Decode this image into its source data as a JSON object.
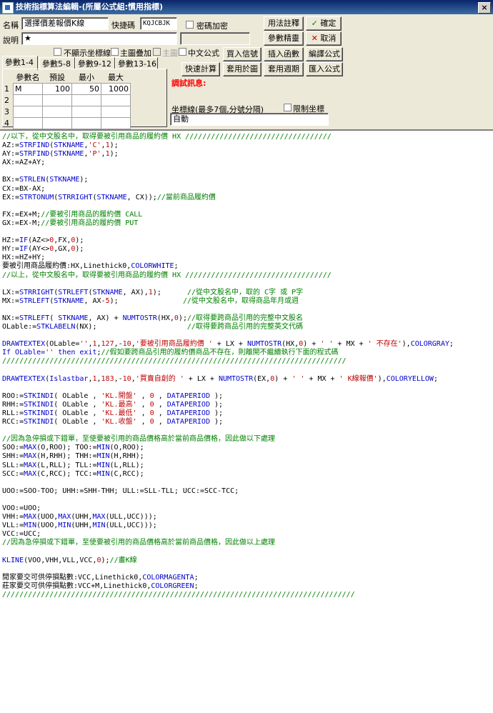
{
  "window": {
    "title": "技術指標算法編輯-(所屬公式組:慣用指標)",
    "close_label": "×"
  },
  "form": {
    "name_label": "名稱",
    "name_value": "選擇價差報價K線",
    "shortcut_label": "快捷碼",
    "shortcut_value": "KQJCBJK",
    "password_label": "密碼加密",
    "desc_label": "說明",
    "desc_value": "★",
    "no_axis_label": "不顯示坐標線",
    "main_overlay_label": "主圖疊加",
    "main_label": "主圖",
    "chinese_formula_label": "中文公式",
    "error_label": "調試訊息:",
    "axis_label": "坐標線(最多7個,分號分隔)",
    "limit_axis_label": "限制坐標",
    "axis_value": "自動"
  },
  "buttons": {
    "usage_note": "用法註釋",
    "ok": "確定",
    "param_wizard": "參數精靈",
    "cancel": "取消",
    "buy_sell": "買入信號",
    "insert_func": "插入函數",
    "compile": "編譯公式",
    "quick_calc": "快速計算",
    "apply_chart": "套用於圖",
    "apply_period": "套用週期",
    "import_formula": "匯入公式"
  },
  "tabs": [
    "參數1-4",
    "參數5-8",
    "參數9-12",
    "參數13-16"
  ],
  "params": {
    "headers": [
      "參數名",
      "預設",
      "最小",
      "最大"
    ],
    "rows": [
      {
        "n": "1",
        "name": "M",
        "def": "100",
        "min": "50",
        "max": "1000"
      },
      {
        "n": "2",
        "name": "",
        "def": "",
        "min": "",
        "max": ""
      },
      {
        "n": "3",
        "name": "",
        "def": "",
        "min": "",
        "max": ""
      },
      {
        "n": "4",
        "name": "",
        "def": "",
        "min": "",
        "max": ""
      }
    ]
  },
  "code_lines": [
    [
      [
        "cm",
        "//以下，從中文股名中，取得要被引用商品的履約價 HX //////////////////////////////////"
      ]
    ],
    [
      [
        "pl",
        "AZ:="
      ],
      [
        "kw",
        "STRFIND"
      ],
      [
        "pl",
        "("
      ],
      [
        "kw",
        "STKNAME"
      ],
      [
        "pl",
        ","
      ],
      [
        "st",
        "'C'"
      ],
      [
        "pl",
        ","
      ],
      [
        "nm",
        "1"
      ],
      [
        "pl",
        ");"
      ]
    ],
    [
      [
        "pl",
        "AY:="
      ],
      [
        "kw",
        "STRFIND"
      ],
      [
        "pl",
        "("
      ],
      [
        "kw",
        "STKNAME"
      ],
      [
        "pl",
        ","
      ],
      [
        "st",
        "'P'"
      ],
      [
        "pl",
        ","
      ],
      [
        "nm",
        "1"
      ],
      [
        "pl",
        ");"
      ]
    ],
    [
      [
        "pl",
        "AX:=AZ+AY;"
      ]
    ],
    [
      [
        "pl",
        ""
      ]
    ],
    [
      [
        "pl",
        "BX:="
      ],
      [
        "kw",
        "STRLEN"
      ],
      [
        "pl",
        "("
      ],
      [
        "kw",
        "STKNAME"
      ],
      [
        "pl",
        ");"
      ]
    ],
    [
      [
        "pl",
        "CX:=BX-AX;"
      ]
    ],
    [
      [
        "pl",
        "EX:="
      ],
      [
        "kw",
        "STRTONUM"
      ],
      [
        "pl",
        "("
      ],
      [
        "kw",
        "STRRIGHT"
      ],
      [
        "pl",
        "("
      ],
      [
        "kw",
        "STKNAME"
      ],
      [
        "pl",
        ", CX));"
      ],
      [
        "cm",
        "//當前商品履約價"
      ]
    ],
    [
      [
        "pl",
        ""
      ]
    ],
    [
      [
        "pl",
        "FX:=EX+M;"
      ],
      [
        "cm",
        "//要被引用商品的履約價 CALL"
      ]
    ],
    [
      [
        "pl",
        "GX:=EX-M;"
      ],
      [
        "cm",
        "//要被引用商品的履約價 PUT"
      ]
    ],
    [
      [
        "pl",
        ""
      ]
    ],
    [
      [
        "pl",
        "HZ:="
      ],
      [
        "kw",
        "IF"
      ],
      [
        "pl",
        "(AZ<>"
      ],
      [
        "nm",
        "0"
      ],
      [
        "pl",
        ",FX,"
      ],
      [
        "nm",
        "0"
      ],
      [
        "pl",
        ");"
      ]
    ],
    [
      [
        "pl",
        "HY:="
      ],
      [
        "kw",
        "IF"
      ],
      [
        "pl",
        "(AY<>"
      ],
      [
        "nm",
        "0"
      ],
      [
        "pl",
        ",GX,"
      ],
      [
        "nm",
        "0"
      ],
      [
        "pl",
        ");"
      ]
    ],
    [
      [
        "pl",
        "HX:=HZ+HY;"
      ]
    ],
    [
      [
        "pl",
        "要被引用商品履約價:HX,Linethick0,"
      ],
      [
        "kw",
        "COLORWHITE"
      ],
      [
        "pl",
        ";"
      ]
    ],
    [
      [
        "cm",
        "//以上，從中文股名中，取得要被引用商品的履約價 HX //////////////////////////////////"
      ]
    ],
    [
      [
        "pl",
        ""
      ]
    ],
    [
      [
        "pl",
        "LX:="
      ],
      [
        "kw",
        "STRRIGHT"
      ],
      [
        "pl",
        "("
      ],
      [
        "kw",
        "STRLEFT"
      ],
      [
        "pl",
        "("
      ],
      [
        "kw",
        "STKNAME"
      ],
      [
        "pl",
        ", AX),"
      ],
      [
        "nm",
        "1"
      ],
      [
        "pl",
        ");      "
      ],
      [
        "cm",
        "//從中文股名中，取的 C字 或 P字"
      ]
    ],
    [
      [
        "pl",
        "MX:="
      ],
      [
        "kw",
        "STRLEFT"
      ],
      [
        "pl",
        "("
      ],
      [
        "kw",
        "STKNAME"
      ],
      [
        "pl",
        ", AX-"
      ],
      [
        "nm",
        "5"
      ],
      [
        "pl",
        ");               "
      ],
      [
        "cm",
        "//從中文股名中，取得商品年月或週"
      ]
    ],
    [
      [
        "pl",
        ""
      ]
    ],
    [
      [
        "pl",
        "NX:="
      ],
      [
        "kw",
        "STRLEFT"
      ],
      [
        "pl",
        "( "
      ],
      [
        "kw",
        "STKNAME"
      ],
      [
        "pl",
        ", AX) + "
      ],
      [
        "kw",
        "NUMTOSTR"
      ],
      [
        "pl",
        "(HX,"
      ],
      [
        "nm",
        "0"
      ],
      [
        "pl",
        ");"
      ],
      [
        "cm",
        "//取得要跨商品引用的完整中文股名"
      ]
    ],
    [
      [
        "pl",
        "OLable:="
      ],
      [
        "kw",
        "STKLABELN"
      ],
      [
        "pl",
        "(NX);                     "
      ],
      [
        "cm",
        "//取得要跨商品引用的完整英文代碼"
      ]
    ],
    [
      [
        "pl",
        ""
      ]
    ],
    [
      [
        "kw",
        "DRAWTEXTEX"
      ],
      [
        "pl",
        "(OLable="
      ],
      [
        "st",
        "''"
      ],
      [
        "pl",
        ","
      ],
      [
        "nm",
        "1"
      ],
      [
        "pl",
        ","
      ],
      [
        "nm",
        "127"
      ],
      [
        "pl",
        ",-"
      ],
      [
        "nm",
        "10"
      ],
      [
        "pl",
        ","
      ],
      [
        "st",
        "'要被引用商品履約價 '"
      ],
      [
        "pl",
        " + LX + "
      ],
      [
        "kw",
        "NUMTOSTR"
      ],
      [
        "pl",
        "(HX,"
      ],
      [
        "nm",
        "0"
      ],
      [
        "pl",
        ") + "
      ],
      [
        "st",
        "' '"
      ],
      [
        "pl",
        " + MX + "
      ],
      [
        "st",
        "' 不存在'"
      ],
      [
        "pl",
        "),"
      ],
      [
        "kw",
        "COLORGRAY"
      ],
      [
        "pl",
        ";"
      ]
    ],
    [
      [
        "kw",
        "If OLable="
      ],
      [
        "st",
        "''"
      ],
      [
        "kw",
        " then exit"
      ],
      [
        "pl",
        ";"
      ],
      [
        "cm",
        "//假如要跨商品引用的履約價商品不存在，則離開不繼續執行下面的程式碼"
      ]
    ],
    [
      [
        "cm",
        "////////////////////////////////////////////////////////////////////////////////"
      ]
    ],
    [
      [
        "pl",
        ""
      ]
    ],
    [
      [
        "kw",
        "DRAWTEXTEX"
      ],
      [
        "pl",
        "("
      ],
      [
        "kw",
        "Islastbar"
      ],
      [
        "pl",
        ","
      ],
      [
        "nm",
        "1"
      ],
      [
        "pl",
        ","
      ],
      [
        "nm",
        "183"
      ],
      [
        "pl",
        ",-"
      ],
      [
        "nm",
        "10"
      ],
      [
        "pl",
        ","
      ],
      [
        "st",
        "'買賣自創的 '"
      ],
      [
        "pl",
        " + LX + "
      ],
      [
        "kw",
        "NUMTOSTR"
      ],
      [
        "pl",
        "(EX,"
      ],
      [
        "nm",
        "0"
      ],
      [
        "pl",
        ") + "
      ],
      [
        "st",
        "' '"
      ],
      [
        "pl",
        " + MX + "
      ],
      [
        "st",
        "' K線報價'"
      ],
      [
        "pl",
        "),"
      ],
      [
        "kw",
        "COLORYELLOW"
      ],
      [
        "pl",
        ";"
      ]
    ],
    [
      [
        "pl",
        ""
      ]
    ],
    [
      [
        "pl",
        "ROO:="
      ],
      [
        "kw",
        "STKINDI"
      ],
      [
        "pl",
        "( OLable , "
      ],
      [
        "st",
        "'KL.開盤'"
      ],
      [
        "pl",
        " , "
      ],
      [
        "nm",
        "0"
      ],
      [
        "pl",
        " , "
      ],
      [
        "kw",
        "DATAPERIOD"
      ],
      [
        "pl",
        " );"
      ]
    ],
    [
      [
        "pl",
        "RHH:="
      ],
      [
        "kw",
        "STKINDI"
      ],
      [
        "pl",
        "( OLable , "
      ],
      [
        "st",
        "'KL.最高'"
      ],
      [
        "pl",
        " , "
      ],
      [
        "nm",
        "0"
      ],
      [
        "pl",
        " , "
      ],
      [
        "kw",
        "DATAPERIOD"
      ],
      [
        "pl",
        " );"
      ]
    ],
    [
      [
        "pl",
        "RLL:="
      ],
      [
        "kw",
        "STKINDI"
      ],
      [
        "pl",
        "( OLable , "
      ],
      [
        "st",
        "'KL.最低'"
      ],
      [
        "pl",
        " , "
      ],
      [
        "nm",
        "0"
      ],
      [
        "pl",
        " , "
      ],
      [
        "kw",
        "DATAPERIOD"
      ],
      [
        "pl",
        " );"
      ]
    ],
    [
      [
        "pl",
        "RCC:="
      ],
      [
        "kw",
        "STKINDI"
      ],
      [
        "pl",
        "( OLable , "
      ],
      [
        "st",
        "'KL.收盤'"
      ],
      [
        "pl",
        " , "
      ],
      [
        "nm",
        "0"
      ],
      [
        "pl",
        " , "
      ],
      [
        "kw",
        "DATAPERIOD"
      ],
      [
        "pl",
        " );"
      ]
    ],
    [
      [
        "pl",
        ""
      ]
    ],
    [
      [
        "cm",
        "//因為急停損或下錯單，至使要被引用的商品價格高於當前商品價格，因此做以下處理"
      ]
    ],
    [
      [
        "pl",
        "SOO:="
      ],
      [
        "kw",
        "MAX"
      ],
      [
        "pl",
        "(O,ROO); TOO:="
      ],
      [
        "kw",
        "MIN"
      ],
      [
        "pl",
        "(O,ROO);"
      ]
    ],
    [
      [
        "pl",
        "SHH:="
      ],
      [
        "kw",
        "MAX"
      ],
      [
        "pl",
        "(H,RHH); THH:="
      ],
      [
        "kw",
        "MIN"
      ],
      [
        "pl",
        "(H,RHH);"
      ]
    ],
    [
      [
        "pl",
        "SLL:="
      ],
      [
        "kw",
        "MAX"
      ],
      [
        "pl",
        "(L,RLL); TLL:="
      ],
      [
        "kw",
        "MIN"
      ],
      [
        "pl",
        "(L,RLL);"
      ]
    ],
    [
      [
        "pl",
        "SCC:="
      ],
      [
        "kw",
        "MAX"
      ],
      [
        "pl",
        "(C,RCC); TCC:="
      ],
      [
        "kw",
        "MIN"
      ],
      [
        "pl",
        "(C,RCC);"
      ]
    ],
    [
      [
        "pl",
        ""
      ]
    ],
    [
      [
        "pl",
        "UOO:=SOO-TOO; UHH:=SHH-THH; ULL:=SLL-TLL; UCC:=SCC-TCC;"
      ]
    ],
    [
      [
        "pl",
        ""
      ]
    ],
    [
      [
        "pl",
        "VOO:=UOO;"
      ]
    ],
    [
      [
        "pl",
        "VHH:="
      ],
      [
        "kw",
        "MAX"
      ],
      [
        "pl",
        "(UOO,"
      ],
      [
        "kw",
        "MAX"
      ],
      [
        "pl",
        "(UHH,"
      ],
      [
        "kw",
        "MAX"
      ],
      [
        "pl",
        "(ULL,UCC)));"
      ]
    ],
    [
      [
        "pl",
        "VLL:="
      ],
      [
        "kw",
        "MIN"
      ],
      [
        "pl",
        "(UOO,"
      ],
      [
        "kw",
        "MIN"
      ],
      [
        "pl",
        "(UHH,"
      ],
      [
        "kw",
        "MIN"
      ],
      [
        "pl",
        "(ULL,UCC)));"
      ]
    ],
    [
      [
        "pl",
        "VCC:=UCC;"
      ]
    ],
    [
      [
        "cm",
        "//因為急停損或下錯單，至使要被引用的商品價格高於當前商品價格，因此做以上處理"
      ]
    ],
    [
      [
        "pl",
        ""
      ]
    ],
    [
      [
        "kw",
        "KLINE"
      ],
      [
        "pl",
        "(VOO,VHH,VLL,VCC,"
      ],
      [
        "nm",
        "0"
      ],
      [
        "pl",
        ");"
      ],
      [
        "cm",
        "//畫K線"
      ]
    ],
    [
      [
        "pl",
        ""
      ]
    ],
    [
      [
        "pl",
        "閒家要交可供停損點數:VCC,Linethick0,"
      ],
      [
        "kw",
        "COLORMAGENTA"
      ],
      [
        "pl",
        ";"
      ]
    ],
    [
      [
        "pl",
        "莊家要交可供停損點數:VCC+M,Linethick0,"
      ],
      [
        "kw",
        "COLORGREEN"
      ],
      [
        "pl",
        ";"
      ]
    ],
    [
      [
        "cm",
        "//////////////////////////////////////////////////////////////////////////////////"
      ]
    ]
  ]
}
